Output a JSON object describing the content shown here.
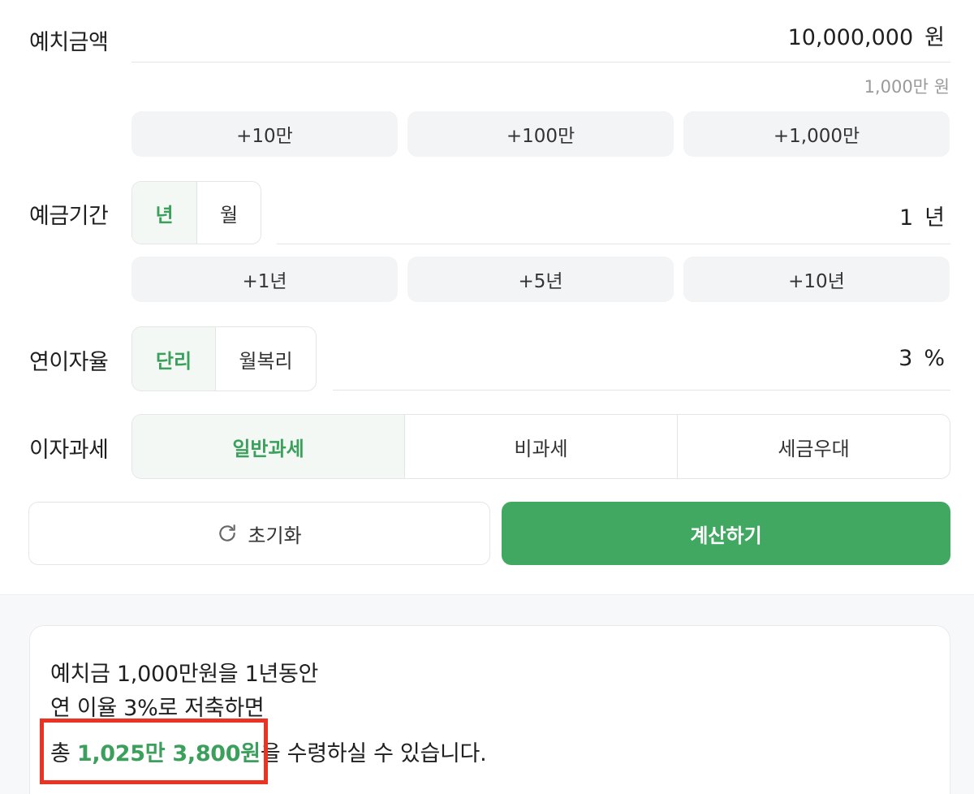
{
  "deposit": {
    "label": "예치금액",
    "value": "10,000,000",
    "unit": "원",
    "helper": "1,000만 원",
    "quick_buttons": [
      "+10만",
      "+100만",
      "+1,000만"
    ]
  },
  "period": {
    "label": "예금기간",
    "toggle": [
      "년",
      "월"
    ],
    "value": "1",
    "unit": "년",
    "quick_buttons": [
      "+1년",
      "+5년",
      "+10년"
    ]
  },
  "rate": {
    "label": "연이자율",
    "toggle": [
      "단리",
      "월복리"
    ],
    "value": "3",
    "unit": "%"
  },
  "tax": {
    "label": "이자과세",
    "options": [
      "일반과세",
      "비과세",
      "세금우대"
    ]
  },
  "actions": {
    "reset_label": "초기화",
    "calculate_label": "계산하기"
  },
  "result": {
    "line1": "예치금 1,000만원을 1년동안",
    "line2": "연 이율 3%로 저축하면",
    "line3_prefix": "총 ",
    "line3_amount": "1,025만 3,800원",
    "line3_suffix": "을 수령하실 수 있습니다."
  },
  "colors": {
    "accent": "#41a862",
    "highlight_box": "#ea3323"
  }
}
